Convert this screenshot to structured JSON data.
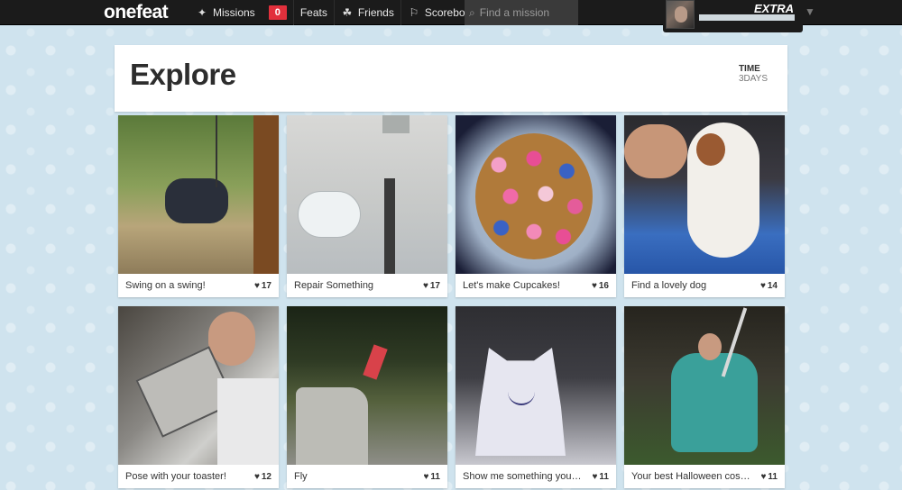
{
  "app": {
    "logo": "onefeat"
  },
  "nav": {
    "items": [
      {
        "label": "Missions",
        "icon": "star-plus-icon",
        "badge": "0"
      },
      {
        "label": "Feats",
        "icon": null
      },
      {
        "label": "Friends",
        "icon": "friends-icon"
      },
      {
        "label": "Scoreboard",
        "icon": "scoreboard-icon"
      }
    ],
    "search_placeholder": "Find a mission"
  },
  "user": {
    "rank": "EXTRA",
    "progress": 1.0
  },
  "page": {
    "title": "Explore",
    "time_label": "TIME",
    "time_value": "3DAYS"
  },
  "missions": [
    {
      "title": "Swing on a swing!",
      "likes": "17"
    },
    {
      "title": "Repair Something",
      "likes": "17"
    },
    {
      "title": "Let's make Cupcakes!",
      "likes": "16"
    },
    {
      "title": "Find a lovely dog",
      "likes": "14"
    },
    {
      "title": "Pose with your toaster!",
      "likes": "12"
    },
    {
      "title": "Fly",
      "likes": "11"
    },
    {
      "title": "Show me something you ...",
      "likes": "11"
    },
    {
      "title": "Your best Halloween cost...",
      "likes": "11"
    }
  ],
  "colors": {
    "topbar": "#1b1b1b",
    "badge": "#e2303c",
    "background": "#cfe3ee"
  }
}
